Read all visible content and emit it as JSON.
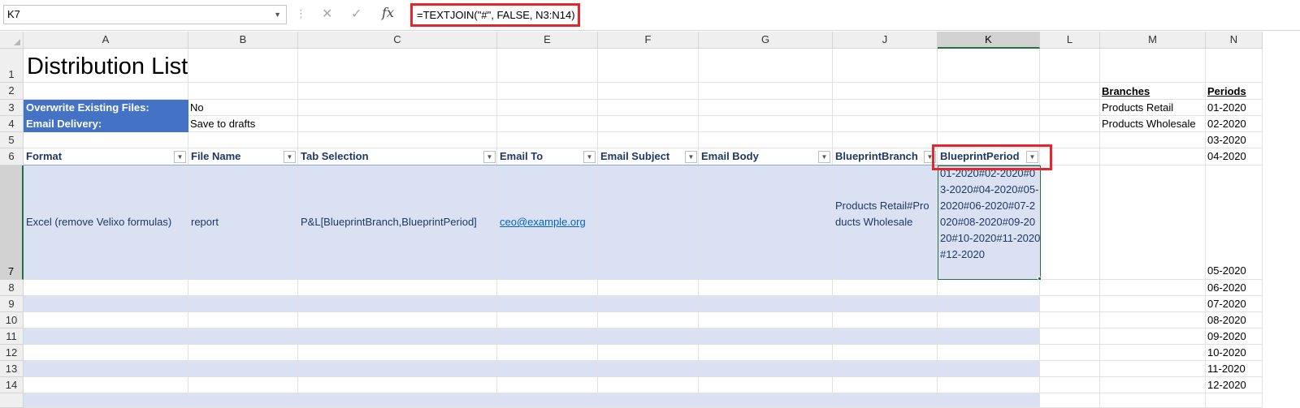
{
  "formula_bar": {
    "name_box": "K7",
    "formula": "=TEXTJOIN(\"#\", FALSE, N3:N14)",
    "fx_label": "fx"
  },
  "columns": [
    "A",
    "B",
    "C",
    "E",
    "F",
    "G",
    "J",
    "K",
    "L",
    "M",
    "N"
  ],
  "rows": [
    "1",
    "2",
    "3",
    "4",
    "5",
    "6",
    "7",
    "8",
    "9",
    "10",
    "11",
    "12",
    "13",
    "14"
  ],
  "sheet": {
    "title": "Distribution List",
    "options": [
      {
        "label": "Overwrite Existing Files:",
        "value": "No"
      },
      {
        "label": "Email Delivery:",
        "value": "Save to drafts"
      }
    ],
    "table_headers": [
      "Format",
      "File Name",
      "Tab Selection",
      "Email To",
      "Email Subject",
      "Email Body",
      "BlueprintBranch",
      "BlueprintPeriod"
    ],
    "row7": {
      "format": "Excel (remove Velixo formulas)",
      "file_name": "report",
      "tab_selection": "P&L[BlueprintBranch,BlueprintPeriod]",
      "email_to": "ceo@example.org",
      "blueprint_branch": "Products Retail#Products Wholesale",
      "blueprint_period": "01-2020#02-2020#03-2020#04-2020#05-2020#06-2020#07-2020#08-2020#09-2020#10-2020#11-2020#12-2020"
    },
    "branches_header": "Branches",
    "branches": [
      "Products Retail",
      "Products Wholesale"
    ],
    "periods_header": "Periods",
    "periods": [
      "01-2020",
      "02-2020",
      "03-2020",
      "04-2020",
      "05-2020",
      "06-2020",
      "07-2020",
      "08-2020",
      "09-2020",
      "10-2020",
      "11-2020",
      "12-2020"
    ]
  },
  "colors": {
    "accent_green": "#217346",
    "highlight_red": "#e8252b",
    "option_fill": "#4472c4",
    "table_band": "#d9e1f2",
    "link": "#0563c1"
  }
}
